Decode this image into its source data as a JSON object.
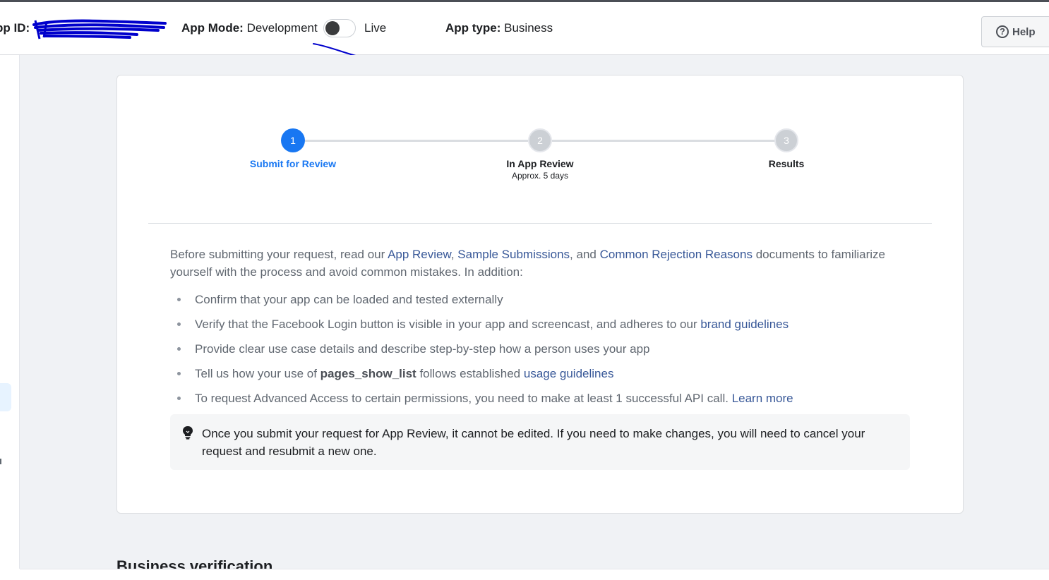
{
  "topbar": {
    "app_id_label": "pp ID:",
    "app_mode_label": "App Mode:",
    "app_mode_value": "Development",
    "live_label": "Live",
    "app_type_label": "App type:",
    "app_type_value": "Business",
    "help_label": "Help"
  },
  "stepper": {
    "steps": [
      {
        "number": "1",
        "label": "Submit for Review",
        "sub": ""
      },
      {
        "number": "2",
        "label": "In App Review",
        "sub": "Approx. 5 days"
      },
      {
        "number": "3",
        "label": "Results",
        "sub": ""
      }
    ]
  },
  "intro": {
    "text_1": "Before submitting your request, read our ",
    "link_1": "App Review",
    "text_2": ", ",
    "link_2": "Sample Submissions",
    "text_3": ", and ",
    "link_3": "Common Rejection Reasons",
    "text_4": " documents to familiarize yourself with the process and avoid common mistakes. In addition:"
  },
  "bullets": {
    "b1": "Confirm that your app can be loaded and tested externally",
    "b2_text": "Verify that the Facebook Login button is visible in your app and screencast, and adheres to our ",
    "b2_link": "brand guidelines",
    "b3": "Provide clear use case details and describe step-by-step how a person uses your app",
    "b4_text_1": "Tell us how your use of ",
    "b4_bold": "pages_show_list",
    "b4_text_2": " follows established ",
    "b4_link": "usage guidelines",
    "b5_text": "To request Advanced Access to certain permissions, you need to make at least 1 successful API call. ",
    "b5_link": "Learn more"
  },
  "notice": {
    "text": "Once you submit your request for App Review, it cannot be edited. If you need to make changes, you will need to cancel your request and resubmit a new one."
  },
  "section": {
    "business_verification": "Business verification"
  },
  "colors": {
    "accent": "#1877f2",
    "link": "#385898",
    "background": "#f0f2f5",
    "annotation_ink": "#0000cc"
  },
  "icons": [
    "help-circle-icon",
    "lightbulb-icon"
  ],
  "toggle_state": "off"
}
